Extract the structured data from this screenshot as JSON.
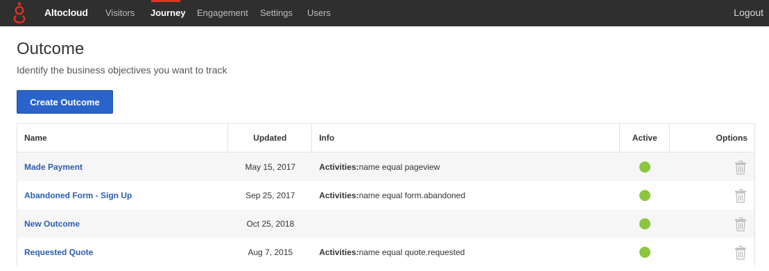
{
  "nav": {
    "brand": "Altocloud",
    "items": [
      {
        "label": "Visitors"
      },
      {
        "label": "Journey"
      },
      {
        "label": "Engagement"
      },
      {
        "label": "Settings"
      },
      {
        "label": "Users"
      }
    ],
    "active": "Journey",
    "logout": "Logout",
    "accent_color": "#e63222"
  },
  "page": {
    "title": "Outcome",
    "subtitle": "Identify the business objectives you want to track",
    "create_button": "Create Outcome"
  },
  "table": {
    "columns": [
      "Name",
      "Updated",
      "Info",
      "Active",
      "Options"
    ],
    "rows": [
      {
        "name": "Made Payment",
        "updated": "May 15, 2017",
        "info_label": "Activities:",
        "info_value": "name equal pageview",
        "active": true
      },
      {
        "name": "Abandoned Form - Sign Up",
        "updated": "Sep 25, 2017",
        "info_label": "Activities:",
        "info_value": "name equal form.abandoned",
        "active": true
      },
      {
        "name": "New Outcome",
        "updated": "Oct 25, 2018",
        "info_label": "",
        "info_value": "",
        "active": true
      },
      {
        "name": "Requested Quote",
        "updated": "Aug 7, 2015",
        "info_label": "Activities:",
        "info_value": "name equal quote.requested",
        "active": true
      }
    ]
  },
  "colors": {
    "active_dot": "#8cc63f",
    "link": "#2a5db0",
    "button": "#2a63c9",
    "navbar": "#2f2f2f"
  }
}
